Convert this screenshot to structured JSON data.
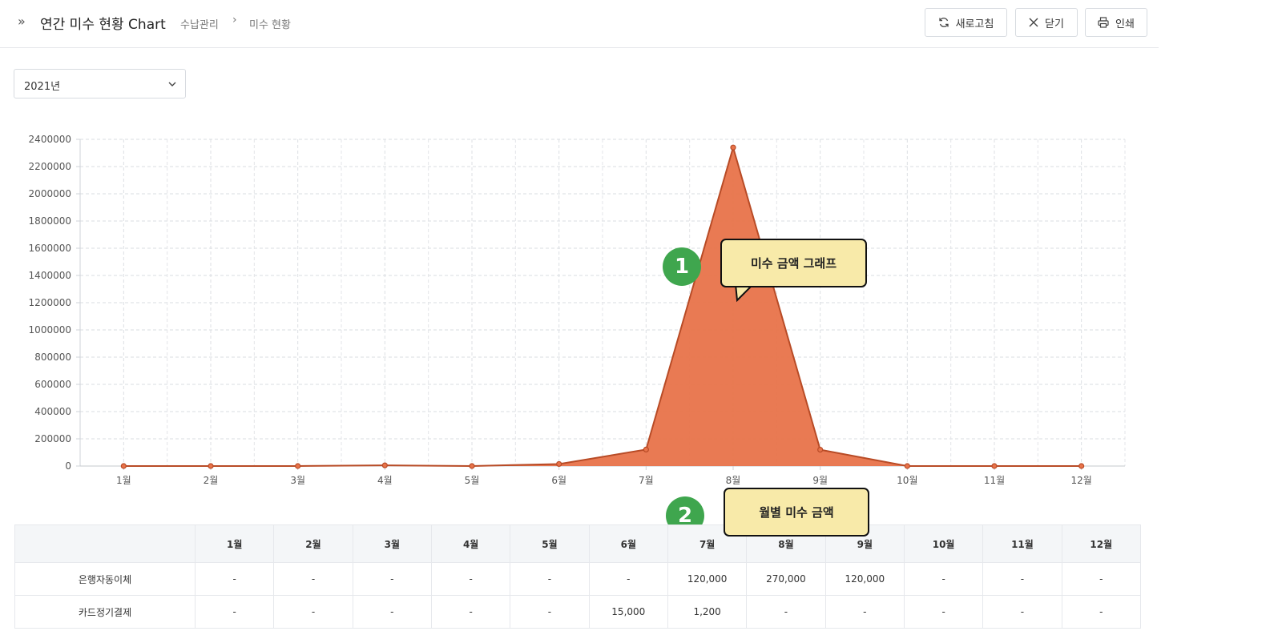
{
  "header": {
    "title": "연간 미수 현황 Chart",
    "breadcrumb": [
      "수납관리",
      "미수 현황"
    ],
    "buttons": {
      "refresh": "새로고침",
      "close": "닫기",
      "print": "인쇄"
    }
  },
  "filters": {
    "year": "2021년"
  },
  "chart_data": {
    "type": "area",
    "categories": [
      "1월",
      "2월",
      "3월",
      "4월",
      "5월",
      "6월",
      "7월",
      "8월",
      "9월",
      "10월",
      "11월",
      "12월"
    ],
    "series": [
      {
        "values": [
          0,
          0,
          0,
          5000,
          0,
          15000,
          121200,
          2340000,
          120000,
          0,
          0,
          0
        ]
      }
    ],
    "yticks": [
      "2400000",
      "2200000",
      "2000000",
      "1800000",
      "1600000",
      "1400000",
      "1200000",
      "1000000",
      "800000",
      "600000",
      "400000",
      "200000",
      "0"
    ],
    "ylim": [
      0,
      2400000
    ],
    "grid": true,
    "colors": {
      "fill": "#e8734a",
      "line": "#b84b26"
    }
  },
  "callouts": [
    {
      "number": "1",
      "text": "미수 금액 그래프"
    },
    {
      "number": "2",
      "text": "월별 미수 금액"
    }
  ],
  "table": {
    "columns": [
      "",
      "1월",
      "2월",
      "3월",
      "4월",
      "5월",
      "6월",
      "7월",
      "8월",
      "9월",
      "10월",
      "11월",
      "12월"
    ],
    "rows": [
      [
        "은행자동이체",
        "-",
        "-",
        "-",
        "-",
        "-",
        "-",
        "120,000",
        "270,000",
        "120,000",
        "-",
        "-",
        "-"
      ],
      [
        "카드정기결제",
        "-",
        "-",
        "-",
        "-",
        "-",
        "15,000",
        "1,200",
        "-",
        "-",
        "-",
        "-",
        "-"
      ]
    ]
  }
}
